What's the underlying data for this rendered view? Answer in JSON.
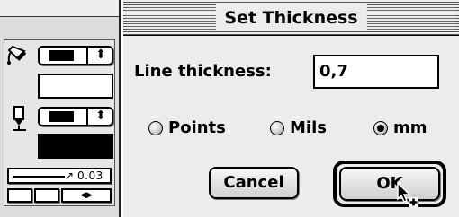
{
  "dialog": {
    "title": "Set Thickness",
    "thickness_label": "Line thickness:",
    "thickness_value": "0,7",
    "units": [
      {
        "label": "Points",
        "selected": false
      },
      {
        "label": "Mils",
        "selected": false
      },
      {
        "label": "mm",
        "selected": true
      }
    ],
    "cancel_label": "Cancel",
    "ok_label": "OK"
  },
  "palette": {
    "line_width_value": "0.03",
    "line_width_arrow": "↗",
    "popup_arrows": "⬍",
    "scroll_arrows": "◀▶",
    "fill_well_color": "#ffffff",
    "pen_well_color": "#000000",
    "fill_icon": "paint-bucket-icon",
    "pen_icon": "pen-icon"
  }
}
